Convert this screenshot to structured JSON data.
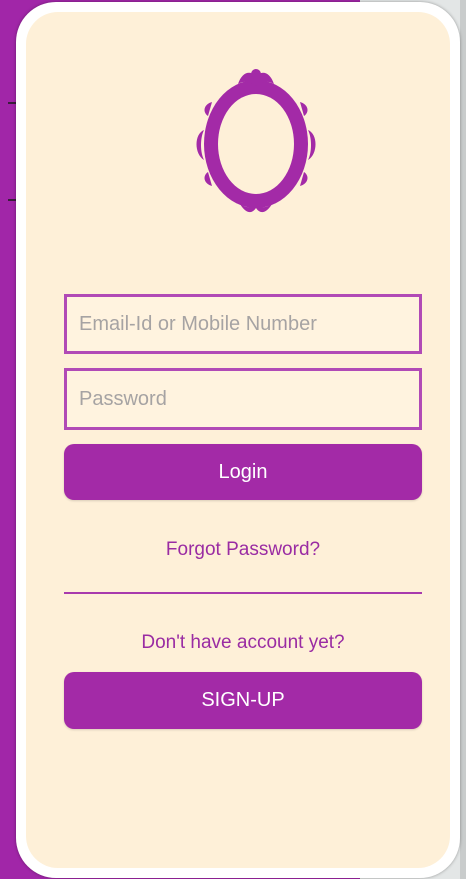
{
  "login_form": {
    "email_placeholder": "Email-Id or Mobile Number",
    "password_placeholder": "Password",
    "login_label": "Login",
    "forgot_password_label": "Forgot Password?"
  },
  "signup": {
    "prompt": "Don't have account yet?",
    "button_label": "SIGN-UP"
  },
  "colors": {
    "accent": "#a32aa7",
    "card_background": "#fef0d8",
    "page_background": "#a126a8"
  },
  "icons": {
    "logo": "ornate-mirror-frame-icon"
  }
}
